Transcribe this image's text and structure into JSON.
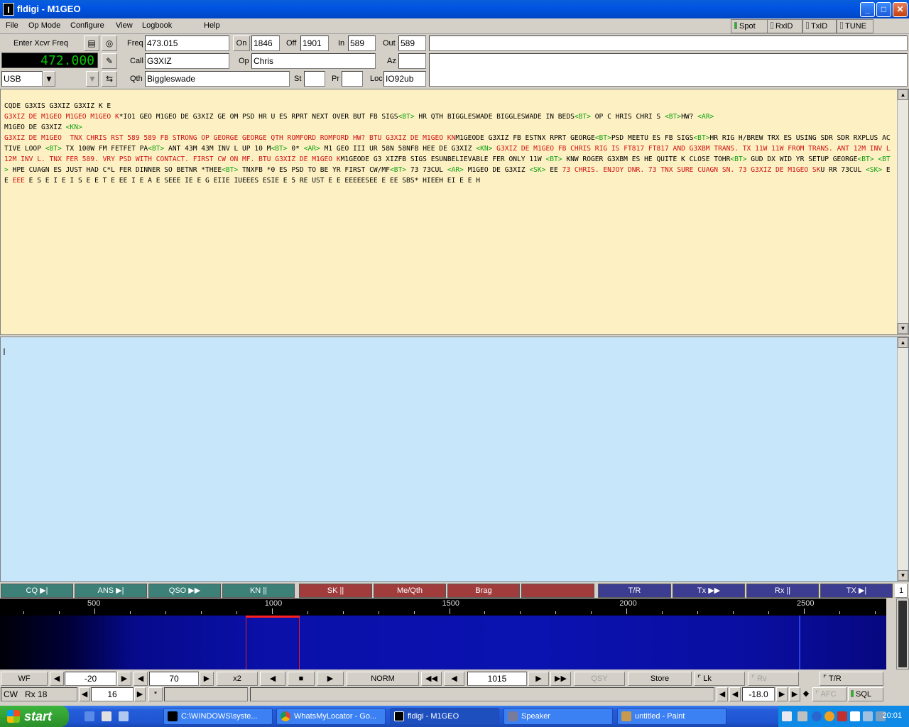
{
  "window": {
    "title": "fldigi - M1GEO",
    "app_icon": "fldigi-icon"
  },
  "menus": [
    "File",
    "Op Mode",
    "Configure",
    "View",
    "Logbook",
    "Help"
  ],
  "indicators": {
    "spot": "Spot",
    "rxid": "RxID",
    "txid": "TxID",
    "tune": "TUNE"
  },
  "log": {
    "enter_freq_label": "Enter Xcvr Freq",
    "freq_label": "Freq",
    "freq": "473.015",
    "on_label": "On",
    "on": "1846",
    "off_label": "Off",
    "off": "1901",
    "in_label": "In",
    "in": "589",
    "out_label": "Out",
    "out": "589",
    "call_label": "Call",
    "call": "G3XIZ",
    "op_label": "Op",
    "op": "Chris",
    "az_label": "Az",
    "az": "",
    "qth_label": "Qth",
    "qth": "Biggleswade",
    "st_label": "St",
    "st": "",
    "pr_label": "Pr",
    "pr": "",
    "loc_label": "Loc",
    "loc": "IO92ub",
    "xcvr_freq": "472.000",
    "mode": "USB"
  },
  "rx_text": [
    [
      [
        "k",
        "CQDE G3XIS G3XIZ G3XIZ K E"
      ]
    ],
    [
      [
        "r",
        "G3XIZ DE M1GEO M1GEO M1GEO K"
      ],
      [
        "k",
        "*IO1 GEO M1GEO DE G3XIZ GE OM PSD HR U ES RPRT NEXT OVER BUT FB SIGS"
      ],
      [
        "g",
        "<BT>"
      ],
      [
        "k",
        " HR QTH BIGGLESWADE BIGGLESWADE IN BEDS"
      ],
      [
        "g",
        "<BT>"
      ],
      [
        "k",
        " OP C HRIS CHRI S "
      ],
      [
        "g",
        "<BT>"
      ],
      [
        "k",
        "HW? "
      ],
      [
        "g",
        "<AR>"
      ]
    ],
    [
      [
        "k",
        "M1GEO DE G3XIZ "
      ],
      [
        "g",
        "<KN>"
      ]
    ],
    [
      [
        "r",
        "G3XIZ DE M1GEO  TNX CHRIS RST 589 589 FB STRONG OP GEORGE GEORGE QTH ROMFORD ROMFORD HW? BTU G3XIZ DE M1GEO KN"
      ],
      [
        "k",
        "M1GEODE G3XIZ FB ESTNX RPRT GEORGE"
      ],
      [
        "g",
        "<BT>"
      ],
      [
        "k",
        "PSD MEETU ES FB SIGS"
      ],
      [
        "g",
        "<BT>"
      ],
      [
        "k",
        "HR RIG H/BREW TRX ES USING SDR SDR RXPLUS ACTIVE LOOP "
      ],
      [
        "g",
        "<BT>"
      ],
      [
        "k",
        " TX 100W FM FETFET PA"
      ],
      [
        "g",
        "<BT>"
      ],
      [
        "k",
        " ANT 43M 43M INV L UP 10 M"
      ],
      [
        "g",
        "<BT>"
      ],
      [
        "k",
        " 0* "
      ],
      [
        "g",
        "<AR>"
      ],
      [
        "k",
        " M1 GEO III UR 58N 58NFB HEE DE G3XIZ "
      ],
      [
        "g",
        "<KN>"
      ],
      [
        "r",
        " G3XIZ DE M1GEO FB CHRIS RIG IS FT817 FT817 AND G3XBM TRANS. TX 11W 11W FROM TRANS. ANT 12M INV L 12M INV L. TNX FER 589. VRY PSD WITH CONTACT. FIRST CW ON MF. BTU G3XIZ DE M1GEO K"
      ],
      [
        "k",
        "M1GEODE G3 XIZFB SIGS ESUNBELIEVABLE FER ONLY 11W "
      ],
      [
        "g",
        "<BT>"
      ],
      [
        "k",
        " KNW ROGER G3XBM ES HE QUITE K CLOSE TOHR"
      ],
      [
        "g",
        "<BT>"
      ],
      [
        "k",
        " GUD DX WID YR SETUP GEORGE"
      ],
      [
        "g",
        "<BT>"
      ],
      [
        "k",
        " "
      ],
      [
        "g",
        "<BT>"
      ],
      [
        "k",
        " HPE CUAGN ES JUST HAD C*L FER DINNER SO BETNR *THEE"
      ],
      [
        "g",
        "<BT>"
      ],
      [
        "k",
        " TNXFB *0 ES PSD TO BE YR FIRST CW/MF"
      ],
      [
        "g",
        "<BT>"
      ],
      [
        "k",
        " 73 73CUL "
      ],
      [
        "g",
        "<AR>"
      ],
      [
        "k",
        " M1GEO DE G3XIZ "
      ],
      [
        "g",
        "<SK>"
      ],
      [
        "k",
        " EE "
      ],
      [
        "r",
        "73 CHRIS. ENJOY DNR. 73 TNX SURE CUAGN SN. 73 G3XIZ DE M1GEO SK"
      ],
      [
        "k",
        "U RR 73CUL "
      ],
      [
        "g",
        "<SK>"
      ],
      [
        "k",
        " E E "
      ],
      [
        "r",
        "EEE"
      ],
      [
        "k",
        " E S E I E I S E E T E EE I E A E SEEE IE E G EIIE IUEEES ESIE E 5 RE UST E E EEEEESEE E EE SBS* HIEEH EI E E H"
      ]
    ]
  ],
  "macros": [
    "CQ",
    "ANS",
    "QSO",
    "KN",
    "SK",
    "Me/Qth",
    "Brag",
    "",
    "T/R",
    "Tx",
    "Rx",
    "TX"
  ],
  "macro_icons": [
    "play-stop-icon",
    "play-stop-icon",
    "fast-forward-icon",
    "pause-icon",
    "pause-icon",
    "",
    "",
    "",
    "",
    "fast-forward-icon",
    "pause-icon",
    "play-stop-icon"
  ],
  "macro_page": "1",
  "waterfall": {
    "ticks": [
      "500",
      "1000",
      "1500",
      "2000",
      "2500"
    ]
  },
  "controls": {
    "wf": "WF",
    "wf_ref": "-20",
    "wf_range": "70",
    "zoom": "x2",
    "norm": "NORM",
    "carrier": "1015",
    "qsy": "QSY",
    "store": "Store",
    "lk": "Lk",
    "rv": "Rv",
    "tr": "T/R"
  },
  "status": {
    "mode": "CW",
    "rx": "Rx 18",
    "wpm": "16",
    "star": "*",
    "level": "-18.0",
    "afc": "AFC",
    "sql": "SQL"
  },
  "taskbar": {
    "start": "start",
    "tasks": [
      "C:\\WINDOWS\\syste...",
      "WhatsMyLocator - Go...",
      "fldigi - M1GEO",
      "Speaker",
      "untitled - Paint"
    ],
    "clock": "20:01"
  },
  "colors": {
    "rx_bg": "#fdf1c4",
    "tx_bg": "#c8e6fa",
    "rx_echo": "#d01010",
    "prosign": "#10a010"
  }
}
